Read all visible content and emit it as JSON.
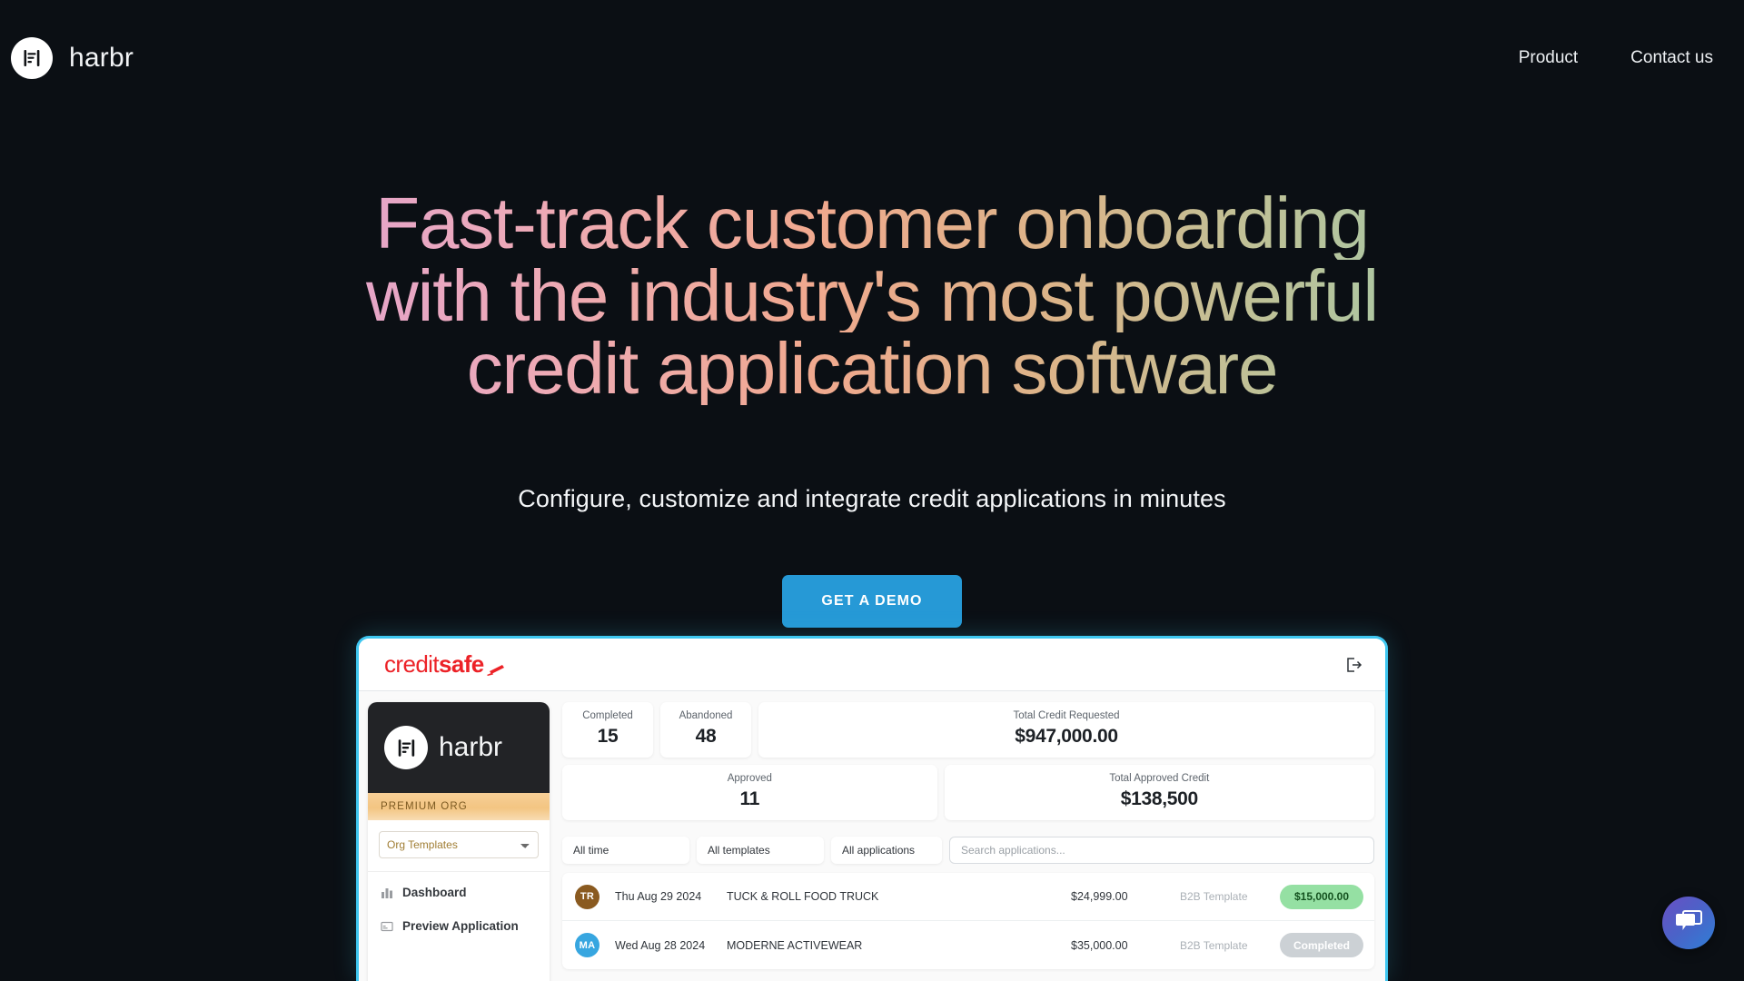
{
  "nav": {
    "brand_name": "harbr",
    "brand_icon": "harbr-logo-icon",
    "links": [
      {
        "label": "Product"
      },
      {
        "label": "Contact us"
      }
    ]
  },
  "hero": {
    "headline_lines": [
      "Fast-track customer onboarding",
      "with the industry's most powerful",
      "credit application software"
    ],
    "subhead": "Configure, customize and integrate credit applications in minutes",
    "cta_label": "GET A DEMO",
    "cta_color": "#2699d6",
    "gradient_stops": [
      "#c79be0",
      "#e3a4cf",
      "#eeaab4",
      "#f0a98e",
      "#ddb489",
      "#bfc197",
      "#a3c9a8",
      "#87cfbf"
    ],
    "background_color": "#0b0f14"
  },
  "mockup": {
    "frame_color": "#3ec6f0",
    "topbar": {
      "logo_text_light": "credit",
      "logo_text_bold": "safe",
      "logo_color": "#ec2227",
      "logout_icon": "logout-icon"
    },
    "sidebar": {
      "brand_name": "harbr",
      "brand_icon": "harbr-logo-icon",
      "premium_label": "PREMIUM ORG",
      "premium_color": "#f3c582",
      "template_select_value": "Org Templates",
      "nav_items": [
        {
          "label": "Dashboard",
          "icon": "chart-icon"
        },
        {
          "label": "Preview Application",
          "icon": "window-icon"
        }
      ]
    },
    "stats": {
      "row1": [
        {
          "label": "Completed",
          "value": "15"
        },
        {
          "label": "Abandoned",
          "value": "48"
        },
        {
          "label": "Total Credit Requested",
          "value": "$947,000.00"
        }
      ],
      "row2": [
        {
          "label": "Approved",
          "value": "11"
        },
        {
          "label": "Total Approved Credit",
          "value": "$138,500"
        }
      ]
    },
    "filters": [
      {
        "label": "All time"
      },
      {
        "label": "All templates"
      },
      {
        "label": "All applications"
      }
    ],
    "search_placeholder": "Search applications...",
    "search_value": "",
    "table_rows": [
      {
        "initials": "TR",
        "avatar_color": "#8a5a20",
        "date": "Thu Aug 29 2024",
        "company": "TUCK & ROLL FOOD TRUCK",
        "amount": "$24,999.00",
        "template": "B2B Template",
        "badge_label": "$15,000.00",
        "badge_style": "green"
      },
      {
        "initials": "MA",
        "avatar_color": "#37a6e0",
        "date": "Wed Aug 28 2024",
        "company": "MODERNE ACTIVEWEAR",
        "amount": "$35,000.00",
        "template": "B2B Template",
        "badge_label": "Completed",
        "badge_style": "gray"
      }
    ]
  },
  "chat": {
    "icon": "chat-bubble-icon",
    "gradient_from": "#6a4fc4",
    "gradient_to": "#2f7fd6"
  }
}
